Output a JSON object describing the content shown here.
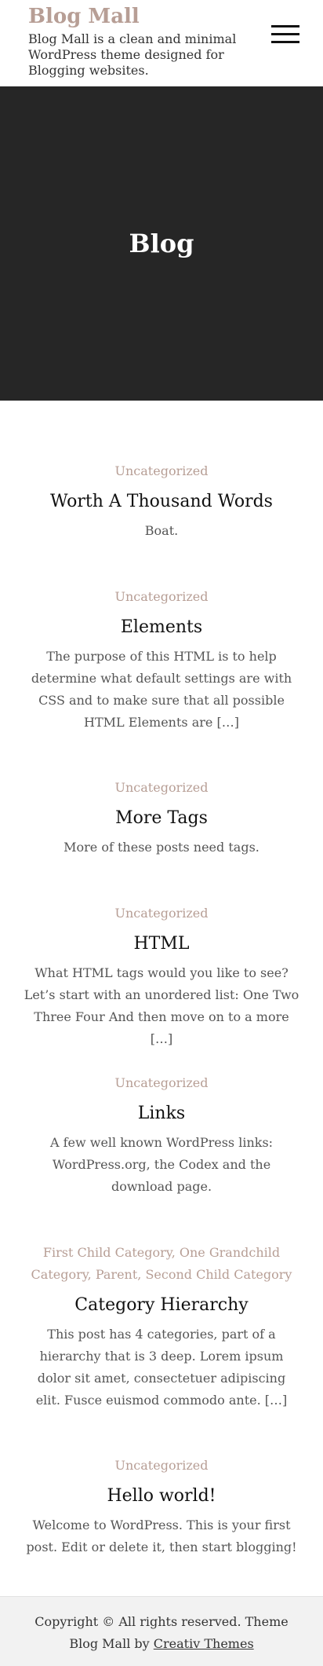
{
  "header": {
    "site_title": "Blog Mall",
    "tagline": "Blog Mall is a clean and minimal WordPress theme designed for Blogging websites.",
    "menu_icon": "hamburger-menu-icon"
  },
  "hero": {
    "title": "Blog"
  },
  "posts": [
    {
      "categories": [
        "Uncategorized"
      ],
      "title": "Worth A Thousand Words",
      "excerpt": "Boat."
    },
    {
      "categories": [
        "Uncategorized"
      ],
      "title": "Elements",
      "excerpt": "The purpose of this HTML is to help determine what default settings are with CSS and to make sure that all possible HTML Elements are […]"
    },
    {
      "categories": [
        "Uncategorized"
      ],
      "title": "More Tags",
      "excerpt": "More of these posts need tags."
    },
    {
      "categories": [
        "Uncategorized"
      ],
      "title": "HTML",
      "excerpt": "What HTML tags would you like to see? Let’s start with an unordered list: One Two Three Four And then move on to a more […]"
    },
    {
      "categories": [
        "Uncategorized"
      ],
      "title": "Links",
      "excerpt": "A few well known WordPress links: WordPress.org, the Codex and the download page."
    },
    {
      "categories": [
        "First Child Category",
        "One Grandchild Category",
        "Parent",
        "Second Child Category"
      ],
      "category_separator": ", ",
      "title": "Category Hierarchy",
      "excerpt": "This post has 4 categories, part of a hierarchy that is 3 deep. Lorem ipsum dolor sit amet, consectetuer adipiscing elit. Fusce euismod commodo ante. […]"
    },
    {
      "categories": [
        "Uncategorized"
      ],
      "title": "Hello world!",
      "excerpt": "Welcome to WordPress. This is your first post. Edit or delete it, then start blogging!"
    }
  ],
  "footer": {
    "copyright": "Copyright © All rights reserved. Theme Blog Mall by ",
    "credit_link": "Creativ Themes"
  },
  "colors": {
    "accent": "#b79e95",
    "hero_bg": "#262626",
    "footer_bg": "#f2f2f2"
  }
}
